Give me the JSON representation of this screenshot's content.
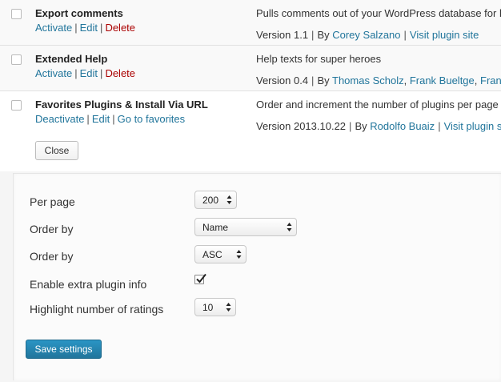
{
  "plugins": [
    {
      "name": "Export comments",
      "actions": [
        "Activate",
        "Edit",
        "Delete"
      ],
      "description": "Pulls comments out of your WordPress database for back",
      "version": "Version 1.1",
      "by": "By",
      "authors": [
        "Corey Salzano"
      ],
      "site_link": "Visit plugin site"
    },
    {
      "name": "Extended Help",
      "actions": [
        "Activate",
        "Edit",
        "Delete"
      ],
      "description": "Help texts for super heroes",
      "version": "Version 0.4",
      "by": "By",
      "authors": [
        "Thomas Scholz",
        "Frank Bueltge",
        "Franz Jo"
      ],
      "site_link": ""
    },
    {
      "name": "Favorites Plugins & Install Via URL",
      "actions": [
        "Deactivate",
        "Edit",
        "Go to favorites"
      ],
      "description": "Order and increment the number of plugins per page in th",
      "version": "Version 2013.10.22",
      "by": "By",
      "authors": [
        "Rodolfo Buaiz"
      ],
      "site_link": "Visit plugin site"
    }
  ],
  "close_label": "Close",
  "settings": {
    "per_page": {
      "label": "Per page",
      "value": "200"
    },
    "order_by_field": {
      "label": "Order by",
      "value": "Name"
    },
    "order_by_dir": {
      "label": "Order by",
      "value": "ASC"
    },
    "extra_info": {
      "label": "Enable extra plugin info",
      "checked": true
    },
    "highlight": {
      "label": "Highlight number of ratings",
      "value": "10"
    },
    "save_label": "Save settings"
  }
}
